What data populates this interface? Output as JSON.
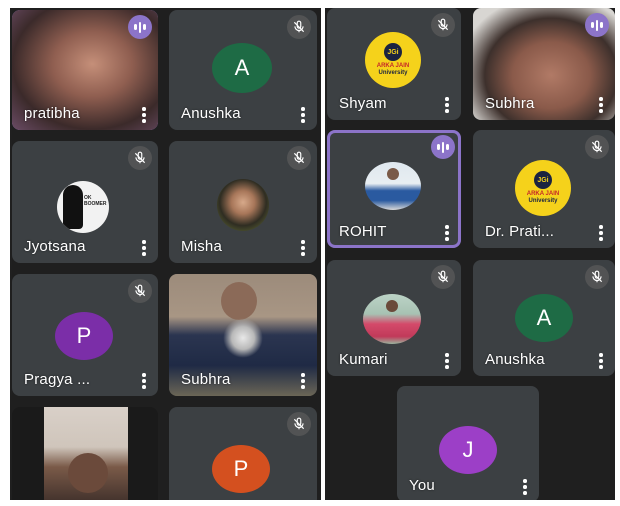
{
  "left_panel": {
    "tiles": [
      {
        "name": "pratibha",
        "status": "speaking"
      },
      {
        "name": "Anushka",
        "avatar_letter": "A",
        "avatar_color": "#1e6b45",
        "status": "muted"
      },
      {
        "name": "Jyotsana",
        "photo_text": "OK BOOMER",
        "status": "muted"
      },
      {
        "name": "Misha",
        "status": "muted"
      },
      {
        "name": "Pragya ...",
        "avatar_letter": "P",
        "avatar_color": "#7b2ea8",
        "status": "muted"
      },
      {
        "name": "Subhra",
        "status": "unmuted"
      },
      {
        "name": "",
        "status": "video"
      },
      {
        "name": "",
        "avatar_letter": "P",
        "avatar_color": "#d4501f",
        "status": "muted"
      }
    ]
  },
  "right_panel": {
    "tiles": [
      {
        "name": "Shyam",
        "logo": {
          "badge": "JGi",
          "line1": "ARKA JAIN",
          "line2": "University"
        },
        "status": "muted"
      },
      {
        "name": "Subhra",
        "status": "speaking"
      },
      {
        "name": "ROHIT",
        "status": "speaking"
      },
      {
        "name": "Dr. Prati...",
        "logo": {
          "badge": "JGi",
          "line1": "ARKA JAIN",
          "line2": "University"
        },
        "status": "muted"
      },
      {
        "name": "Kumari",
        "status": "muted"
      },
      {
        "name": "Anushka",
        "avatar_letter": "A",
        "avatar_color": "#1e6b45",
        "status": "muted"
      },
      {
        "name": "You",
        "avatar_letter": "J",
        "avatar_color": "#9c3fc7",
        "status": "self"
      }
    ]
  },
  "colors": {
    "background": "#1f1f1f",
    "tile": "#3c4043",
    "speaking_accent": "#8c74c9",
    "logo_yellow": "#f5d21b"
  },
  "icons": [
    "mic-off-icon",
    "audio-level-icon",
    "more-options-icon"
  ]
}
